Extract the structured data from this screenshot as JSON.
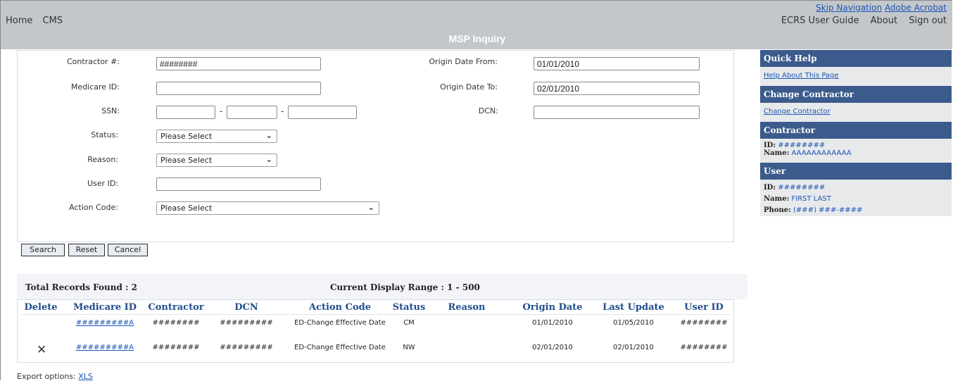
{
  "topnav": {
    "home": "Home",
    "cms": "CMS",
    "skip_navigation": "Skip Navigation",
    "adobe_acrobat": "Adobe Acrobat",
    "user_guide": "ECRS User Guide",
    "about": "About",
    "sign_out": "Sign out"
  },
  "page_title": "MSP Inquiry",
  "form": {
    "contractor_label": "Contractor #:",
    "contractor_value": "########",
    "medicare_id_label": "Medicare ID:",
    "medicare_id_value": "",
    "ssn_label": "SSN:",
    "ssn_sep": "-",
    "status_label": "Status:",
    "status_value": "Please Select",
    "reason_label": "Reason:",
    "reason_value": "Please Select",
    "user_id_label": "User ID:",
    "user_id_value": "",
    "action_code_label": "Action Code:",
    "action_code_value": "Please Select",
    "origin_from_label": "Origin Date From:",
    "origin_from_value": "01/01/2010",
    "origin_to_label": "Origin Date To:",
    "origin_to_value": "02/01/2010",
    "dcn_label": "DCN:",
    "dcn_value": ""
  },
  "buttons": {
    "search": "Search",
    "reset": "Reset",
    "cancel": "Cancel"
  },
  "results": {
    "total": "Total Records Found : 2",
    "range": "Current Display Range : 1 - 500",
    "columns": [
      "Delete",
      "Medicare ID",
      "Contractor",
      "DCN",
      "Action Code",
      "Status",
      "Reason",
      "Origin Date",
      "Last Update",
      "User ID"
    ],
    "rows": [
      {
        "medicare_id": "#########A",
        "contractor": "########",
        "dcn": "#########",
        "action_code": "ED-Change Effective Date",
        "status": "CM",
        "reason": "",
        "origin_date": "01/01/2010",
        "last_update": "01/05/2010",
        "user_id": "########"
      },
      {
        "medicare_id": "#########A",
        "contractor": "########",
        "dcn": "#########",
        "action_code": "ED-Change Effective Date",
        "status": "NW",
        "reason": "",
        "origin_date": "02/01/2010",
        "last_update": "02/01/2010",
        "user_id": "########"
      }
    ],
    "delete_glyph": "✕"
  },
  "export": {
    "label": "Export options:",
    "xls": "XLS"
  },
  "sidebar": {
    "quick_help_title": "Quick Help",
    "help_link": "Help About This Page",
    "change_contractor_title": "Change Contractor",
    "change_contractor_link": "Change Contractor",
    "contractor_title": "Contractor",
    "contractor_id_key": "ID:",
    "contractor_id": "########",
    "contractor_name_key": "Name:",
    "contractor_name": "AAAAAAAAAAAA",
    "user_title": "User",
    "user_id_key": "ID:",
    "user_id": "########",
    "user_name_key": "Name:",
    "user_name": "FIRST LAST",
    "user_phone_key": "Phone:",
    "user_phone": "(###) ###-####"
  },
  "colors": {
    "topbar": "#c4c7ca",
    "sidebar_header": "#3b5b8c",
    "link": "#1a55b8",
    "table_header_text": "#1f4e8c"
  }
}
